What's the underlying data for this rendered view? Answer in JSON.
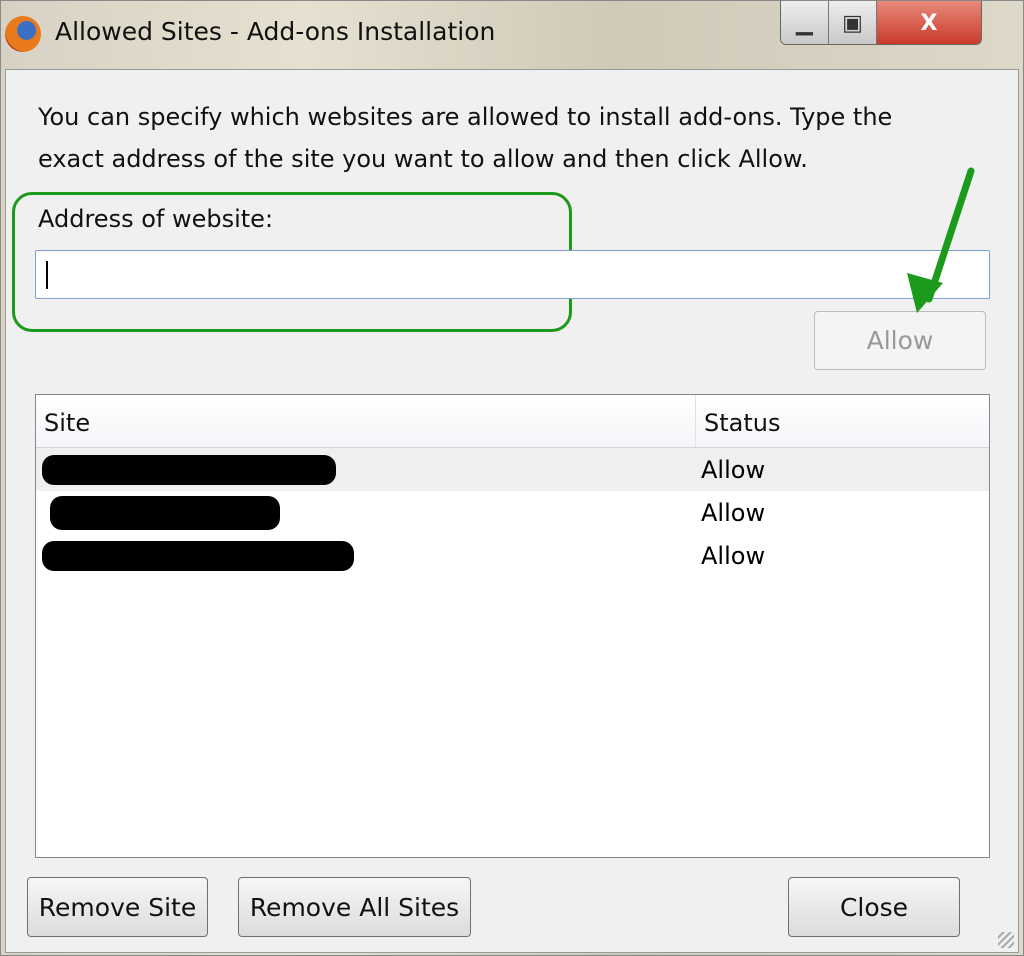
{
  "window": {
    "title": "Allowed Sites - Add-ons Installation",
    "app_icon": "firefox-icon",
    "controls": [
      "minimize",
      "maximize",
      "close"
    ]
  },
  "description": "You can specify which websites are allowed to install add-ons. Type the exact address of the site you want to allow and then click Allow.",
  "address": {
    "label": "Address of website:",
    "value": ""
  },
  "allow_button": "Allow",
  "table": {
    "columns": [
      "Site",
      "Status"
    ],
    "rows": [
      {
        "site_redacted": true,
        "status": "Allow"
      },
      {
        "site_redacted": true,
        "status": "Allow"
      },
      {
        "site_redacted": true,
        "status": "Allow"
      }
    ]
  },
  "buttons": {
    "remove_site": "Remove Site",
    "remove_all": "Remove All Sites",
    "close": "Close"
  },
  "annotation_color": "#1b9a1b"
}
